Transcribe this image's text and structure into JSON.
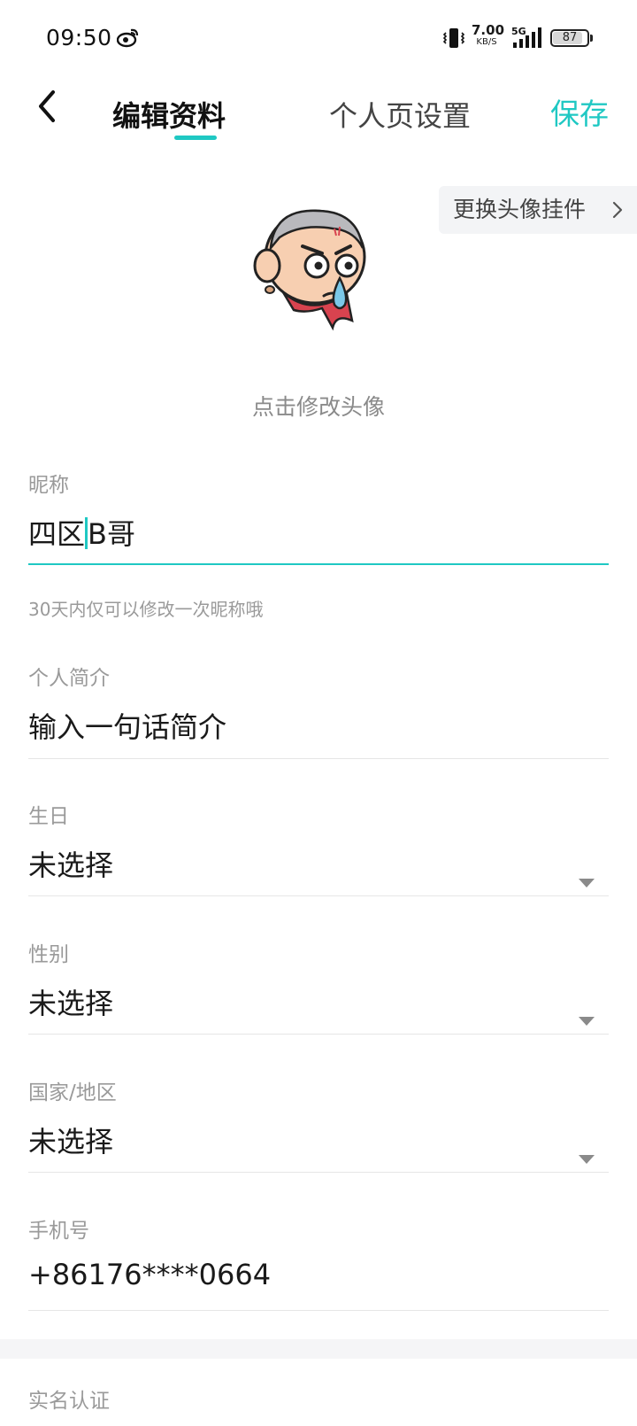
{
  "status_bar": {
    "time": "09:50",
    "net_speed_value": "7.00",
    "net_speed_unit": "KB/S",
    "network_type": "5G",
    "battery_text": "87",
    "battery_level": 0.87
  },
  "header": {
    "tabs": [
      {
        "label": "编辑资料"
      },
      {
        "label": "个人页设置"
      }
    ],
    "save_label": "保存",
    "accent_color": "#1fc8c3"
  },
  "avatar": {
    "pendant_button": "更换头像挂件",
    "hint": "点击修改头像"
  },
  "form": {
    "nickname": {
      "label": "昵称",
      "value_before_cursor": "四区",
      "value_after_cursor": "B哥",
      "hint": "30天内仅可以修改一次昵称哦"
    },
    "bio": {
      "label": "个人简介",
      "placeholder": "输入一句话简介"
    },
    "birthday": {
      "label": "生日",
      "value": "未选择"
    },
    "gender": {
      "label": "性别",
      "value": "未选择"
    },
    "region": {
      "label": "国家/地区",
      "value": "未选择"
    },
    "phone": {
      "label": "手机号",
      "value": "+86176****0664"
    },
    "real_name": {
      "label": "实名认证"
    }
  }
}
